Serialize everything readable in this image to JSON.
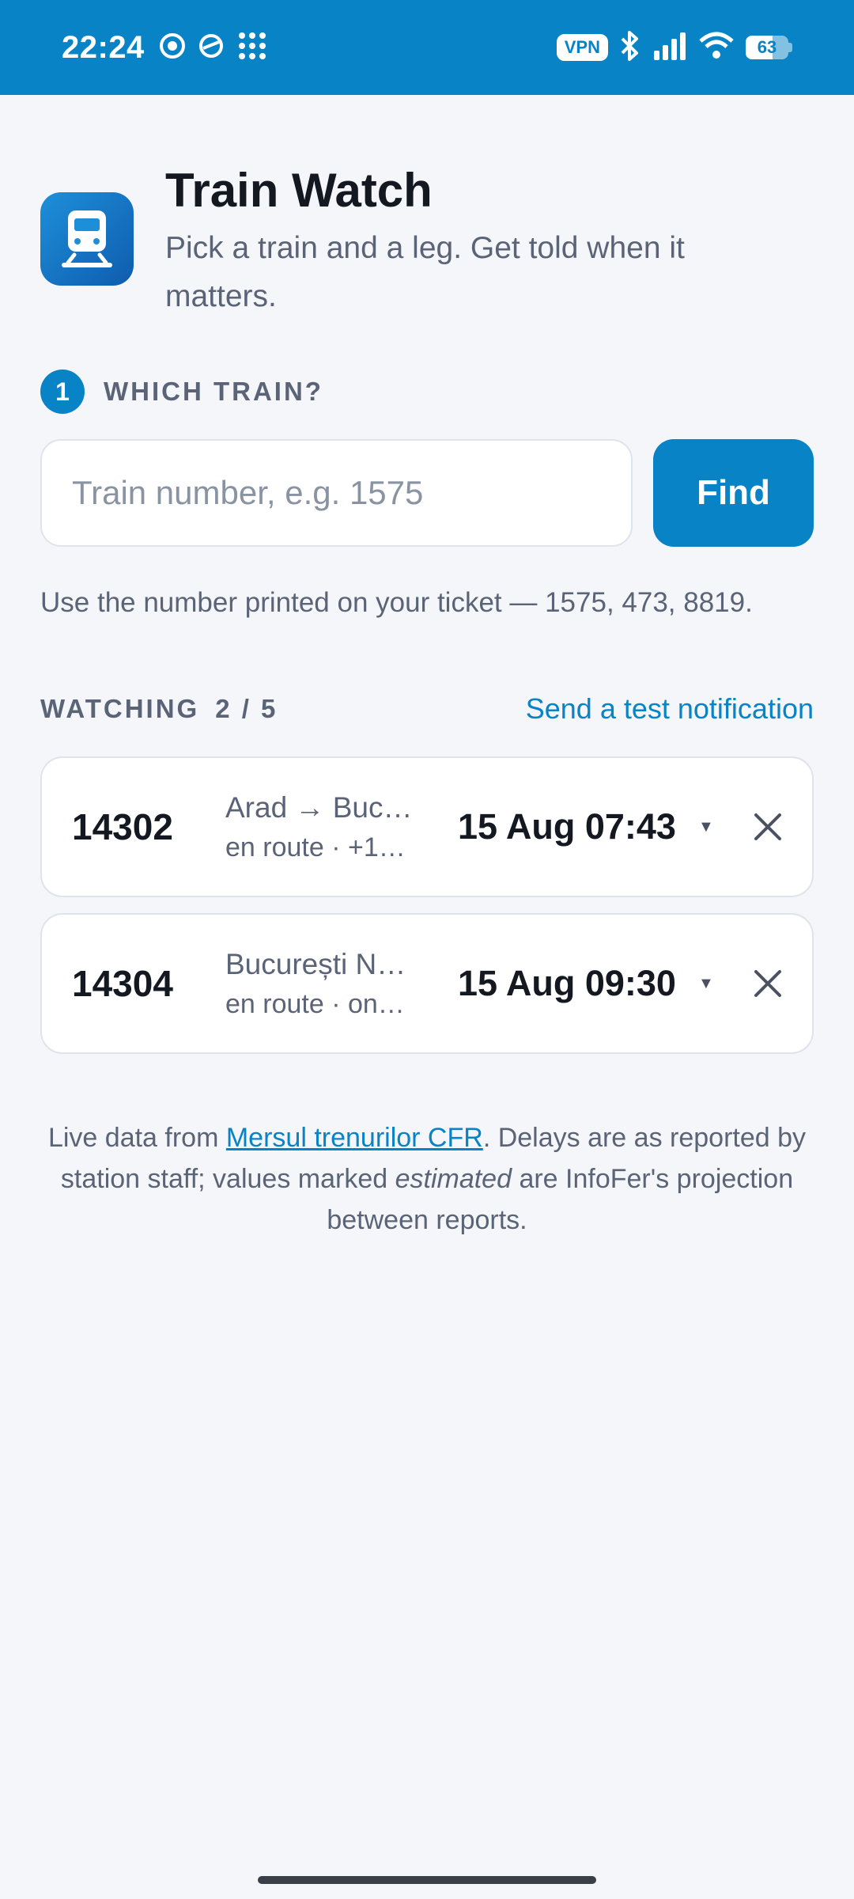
{
  "status_bar": {
    "time": "22:24",
    "vpn": "VPN",
    "battery": "63",
    "battery_level": 0.63,
    "left_icons": [
      "chrome-icon",
      "sync-icon",
      "apps-grid-icon"
    ],
    "right_icons": [
      "vpn-icon",
      "bluetooth-icon",
      "signal-icon",
      "wifi-icon",
      "battery-icon"
    ]
  },
  "header": {
    "title": "Train Watch",
    "subtitle": "Pick a train and a leg. Get told when it matters.",
    "icon": "train-icon"
  },
  "step": {
    "number": "1",
    "label": "WHICH TRAIN?"
  },
  "search": {
    "placeholder": "Train number, e.g. 1575",
    "value": "",
    "button": "Find"
  },
  "hint": "Use the number printed on your ticket — 1575, 473, 8819.",
  "watching": {
    "label": "WATCHING",
    "count": "2 / 5",
    "test_link": "Send a test notification",
    "items": [
      {
        "number": "14302",
        "route": "Arad → Buc…",
        "status": "en route · +1…",
        "time": "15 Aug 07:43"
      },
      {
        "number": "14304",
        "route": "București N…",
        "status": "en route · on…",
        "time": "15 Aug 09:30"
      }
    ]
  },
  "footer": {
    "prefix": "Live data from ",
    "link": "Mersul trenurilor CFR",
    "middle": ". Delays are as reported by station staff; values marked ",
    "emphasis": "estimated",
    "suffix": " are InfoFer's projection between reports."
  },
  "colors": {
    "accent": "#0783c6",
    "background": "#f4f6fa",
    "muted_text": "#5a6476"
  }
}
